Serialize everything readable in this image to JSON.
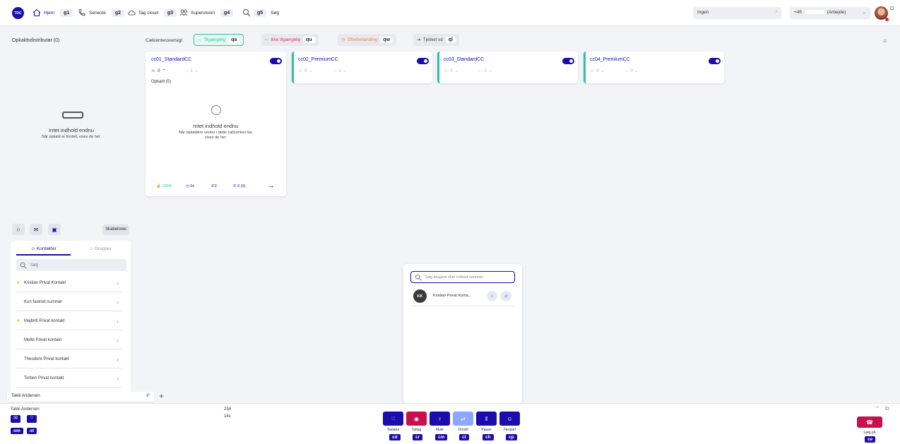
{
  "topbar": {
    "logo": "TDC",
    "nav": [
      {
        "label": "Hjem",
        "kbd": "g1",
        "icon": "home-icon"
      },
      {
        "label": "Seneste",
        "kbd": "g2",
        "icon": "phone-icon"
      },
      {
        "label": "Tag cloud",
        "kbd": "g3",
        "icon": "cloud-icon"
      },
      {
        "label": "Supervision",
        "kbd": "g4",
        "icon": "supervision-icon"
      },
      {
        "label": "Søg",
        "kbd": "g5",
        "icon": "search-icon"
      }
    ],
    "status_select": "Ingen",
    "number_prefix": "+45",
    "number_label": "(Arbejde)"
  },
  "opkald": {
    "title": "Opkaldsdistributør (0)",
    "empty_title": "Intet indhold endnu",
    "empty_sub": "Når opkald er fordelt, vises de her."
  },
  "callcenter": {
    "title": "Callcenteroversigt",
    "chips": [
      {
        "label": "Tilgængelig",
        "kbd": "qa"
      },
      {
        "label": "Ikke tilgængelig",
        "kbd": "qu"
      },
      {
        "label": "Efterbehandling",
        "kbd": "qw"
      },
      {
        "label": "Tjekket ud",
        "kbd": "ql"
      }
    ],
    "cards": [
      {
        "name": "cc01_StandardCC",
        "agents": "0",
        "queue": "1"
      },
      {
        "name": "cc02_PremiumCC",
        "agents": "0",
        "queue": "1"
      },
      {
        "name": "cc03_StandardCC",
        "agents": "0",
        "queue": "0"
      },
      {
        "name": "cc04_PremiumCC",
        "agents": "0",
        "queue": "0"
      }
    ],
    "calls_label": "Opkald (0)",
    "empty_title": "Intet indhold endnu",
    "empty_sub": "Når opkaldere venter i dette callcenters kø, vises de her.",
    "stats": {
      "percent": "100%",
      "time": "0s",
      "answered": "0",
      "missed": "0 (0)"
    }
  },
  "contacts": {
    "templates_label": "Skabeloner",
    "tabs": [
      "Kontakter",
      "Grupper"
    ],
    "search_placeholder": "Søg",
    "items": [
      {
        "name": "Kristian Privat Kontakt",
        "star": true
      },
      {
        "name": "Kun fastnet nummer",
        "star": false
      },
      {
        "name": "Majbritt Privat kontakt",
        "star": true
      },
      {
        "name": "Mette Privat kontakt",
        "star": false
      },
      {
        "name": "Theodore Privat kontakt",
        "star": false
      },
      {
        "name": "Torben Privat kontakt",
        "star": false
      }
    ],
    "current_user": "Takki Andersen"
  },
  "dialer": {
    "search_placeholder": "Søg brugere eller indtast nummer",
    "result_initials": "KK",
    "result_name": "Kristian Privat Konta..."
  },
  "callbar": {
    "user": "Takki Andersen",
    "number": "234",
    "duration": "14s",
    "user_kbds": [
      "om",
      "ot"
    ],
    "buttons": [
      {
        "label": "Tastatur",
        "kbd": "cd",
        "icon": "keypad-icon"
      },
      {
        "label": "Optag",
        "kbd": "cr",
        "icon": "record-icon"
      },
      {
        "label": "Mute",
        "kbd": "cm",
        "icon": "mic-icon"
      },
      {
        "label": "Omstil",
        "kbd": "ct",
        "icon": "transfer-icon"
      },
      {
        "label": "Pause",
        "kbd": "ch",
        "icon": "pause-icon"
      },
      {
        "label": "Flerpart",
        "kbd": "cp",
        "icon": "conference-icon"
      }
    ],
    "hangup_label": "Læg på",
    "hangup_kbd": "ce"
  },
  "colors": {
    "brand": "#1a0dab",
    "available": "#29c4a6",
    "unavailable": "#d6336c",
    "wrapup": "#f07f4f",
    "hangup": "#c8104f"
  }
}
